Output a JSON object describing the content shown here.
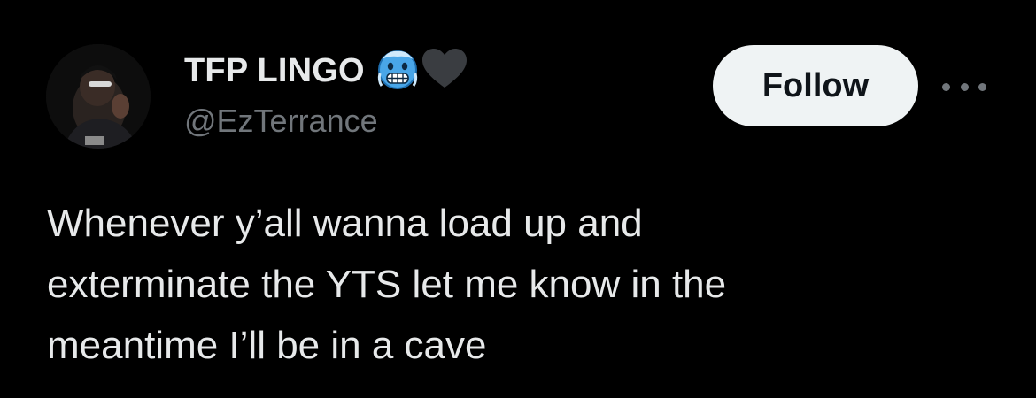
{
  "author": {
    "display_name": "TFP LINGO",
    "handle": "@EzTerrance",
    "name_emojis": [
      "cold-face-emoji",
      "black-heart-emoji"
    ]
  },
  "actions": {
    "follow_label": "Follow",
    "more_icon": "more-horizontal-icon"
  },
  "tweet": {
    "lines": [
      "Whenever y’all wanna load up and",
      "exterminate the YTS let me know in the",
      "meantime I’ll be in a cave"
    ]
  },
  "colors": {
    "background": "#000000",
    "primary_text": "#e7e9ea",
    "secondary_text": "#71767b",
    "follow_button_bg": "#eff3f4",
    "follow_button_text": "#0f1419"
  }
}
